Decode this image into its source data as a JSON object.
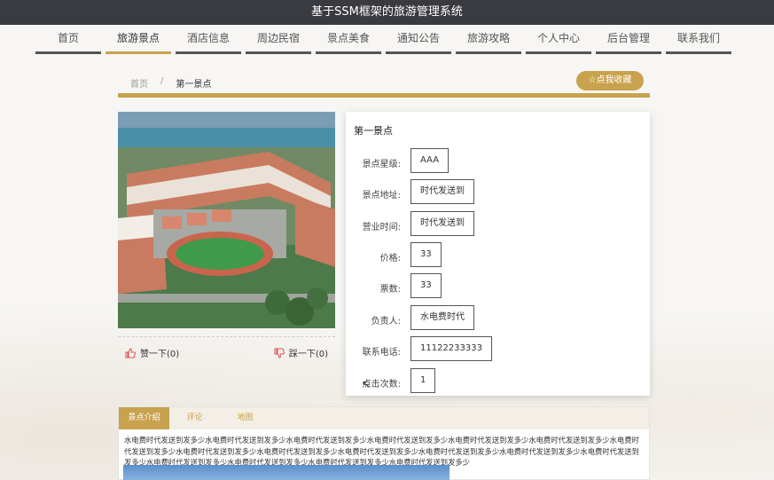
{
  "app": {
    "title": "基于SSM框架的旅游管理系统"
  },
  "nav": {
    "items": [
      {
        "label": "首页",
        "active": false
      },
      {
        "label": "旅游景点",
        "active": true
      },
      {
        "label": "酒店信息",
        "active": false
      },
      {
        "label": "周边民宿",
        "active": false
      },
      {
        "label": "景点美食",
        "active": false
      },
      {
        "label": "通知公告",
        "active": false
      },
      {
        "label": "旅游攻略",
        "active": false
      },
      {
        "label": "个人中心",
        "active": false
      },
      {
        "label": "后台管理",
        "active": false
      },
      {
        "label": "联系我们",
        "active": false
      }
    ]
  },
  "breadcrumb": {
    "home": "首页",
    "separator": "/",
    "current": "第一景点"
  },
  "favorite": {
    "label": "☆点我收藏"
  },
  "votes": {
    "like": "赞一下(0)",
    "dislike": "踩一下(0)"
  },
  "detail": {
    "title": "第一景点",
    "fields": [
      {
        "label": "景点星级:",
        "value": "AAA"
      },
      {
        "label": "景点地址:",
        "value": "时代发送到"
      },
      {
        "label": "营业时间:",
        "value": "时代发送到"
      },
      {
        "label": "价格:",
        "value": "33"
      },
      {
        "label": "票数:",
        "value": "33"
      },
      {
        "label": "负责人:",
        "value": "水电费时代"
      },
      {
        "label": "联系电话:",
        "value": "11122233333"
      },
      {
        "label": "点击次数:",
        "value": "1"
      }
    ]
  },
  "tabs": {
    "items": [
      {
        "label": "景点介绍",
        "active": true
      },
      {
        "label": "评论",
        "active": false
      },
      {
        "label": "地图",
        "active": false
      }
    ],
    "intro": "水电费时代发送到发多少水电费时代发送到发多少水电费时代发送到发多少水电费时代发送到发多少水电费时代发送到发多少水电费时代发送到发多少水电费时代发送到发多少水电费时代发送到发多少水电费时代发送到发多少水电费时代发送到发多少水电费时代发送到发多少水电费时代发送到发多少水电费时代发送到发多少水电费时代发送到发多少水电费时代发送到发多少水电费时代发送到发多少水电费时代发送到发多少"
  },
  "colors": {
    "accent": "#c9a24e",
    "titlebar": "#3a3b40"
  }
}
